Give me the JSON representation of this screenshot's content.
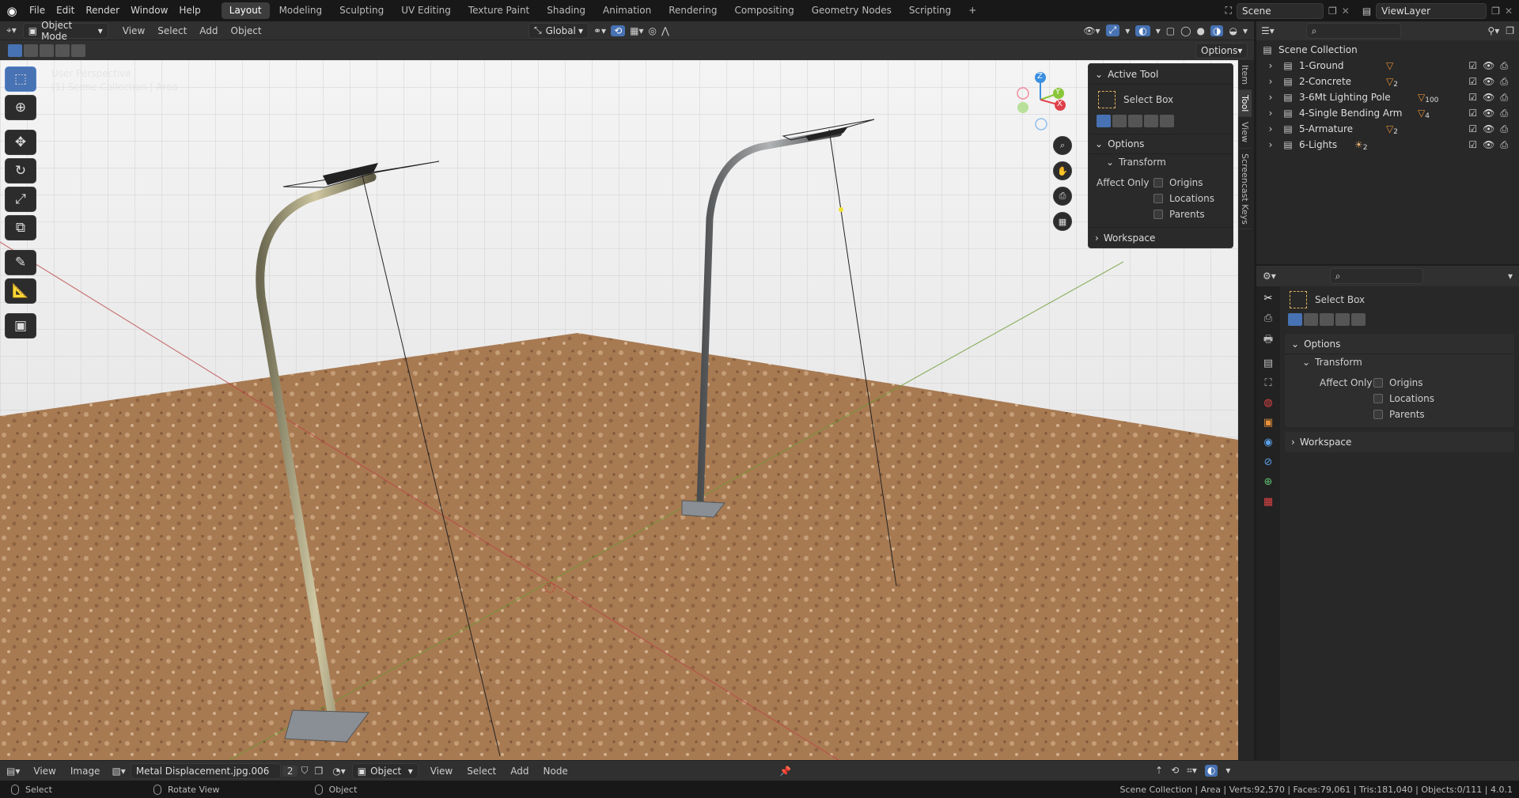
{
  "topbar": {
    "menus": [
      "File",
      "Edit",
      "Render",
      "Window",
      "Help"
    ],
    "workspaces": [
      "Layout",
      "Modeling",
      "Sculpting",
      "UV Editing",
      "Texture Paint",
      "Shading",
      "Animation",
      "Rendering",
      "Compositing",
      "Geometry Nodes",
      "Scripting"
    ],
    "active_workspace": "Layout",
    "add_tab": "+",
    "scene": "Scene",
    "view_layer": "ViewLayer"
  },
  "viewport_header": {
    "mode": "Object Mode",
    "menus": [
      "View",
      "Select",
      "Add",
      "Object"
    ],
    "orientation": "Global",
    "options": "Options"
  },
  "overlay": {
    "perspective": "User Perspective",
    "collection": "(1) Scene Collection | Area"
  },
  "gizmo": {
    "z": "Z",
    "y": "Y",
    "x": "X"
  },
  "sidebar_tabs": [
    "Item",
    "Tool",
    "View",
    "Screencast Keys"
  ],
  "npanel": {
    "active_tool_header": "Active Tool",
    "tool_name": "Select Box",
    "options_header": "Options",
    "transform_header": "Transform",
    "affect_only": "Affect Only",
    "origins": "Origins",
    "locations": "Locations",
    "parents": "Parents",
    "workspace_header": "Workspace"
  },
  "outliner": {
    "root": "Scene Collection",
    "items": [
      {
        "label": "1-Ground",
        "badge": ""
      },
      {
        "label": "2-Concrete",
        "badge": "2"
      },
      {
        "label": "3-6Mt Lighting Pole",
        "badge": "100"
      },
      {
        "label": "4-Single Bending Arm",
        "badge": "4"
      },
      {
        "label": "5-Armature",
        "badge": "2"
      },
      {
        "label": "6-Lights",
        "badge": "2"
      }
    ]
  },
  "properties": {
    "tool_name": "Select Box",
    "options_header": "Options",
    "transform_header": "Transform",
    "affect_only": "Affect Only",
    "origins": "Origins",
    "locations": "Locations",
    "parents": "Parents",
    "workspace_header": "Workspace"
  },
  "bottom": {
    "view": "View",
    "image": "Image",
    "image_name": "Metal Displacement.jpg.006",
    "users": "2",
    "object_type": "Object",
    "menus": [
      "View",
      "Select",
      "Add",
      "Node"
    ]
  },
  "status": {
    "select": "Select",
    "rotate": "Rotate View",
    "object": "Object",
    "stats": "Scene Collection | Area | Verts:92,570 | Faces:79,061 | Tris:181,040 | Objects:0/111 | 4.0.1"
  },
  "colors": {
    "accent": "#4772b3",
    "ground": "#b0825a",
    "gizmo_x": "#e0404a",
    "gizmo_y": "#8ac63a",
    "gizmo_z": "#3b8fe0"
  }
}
